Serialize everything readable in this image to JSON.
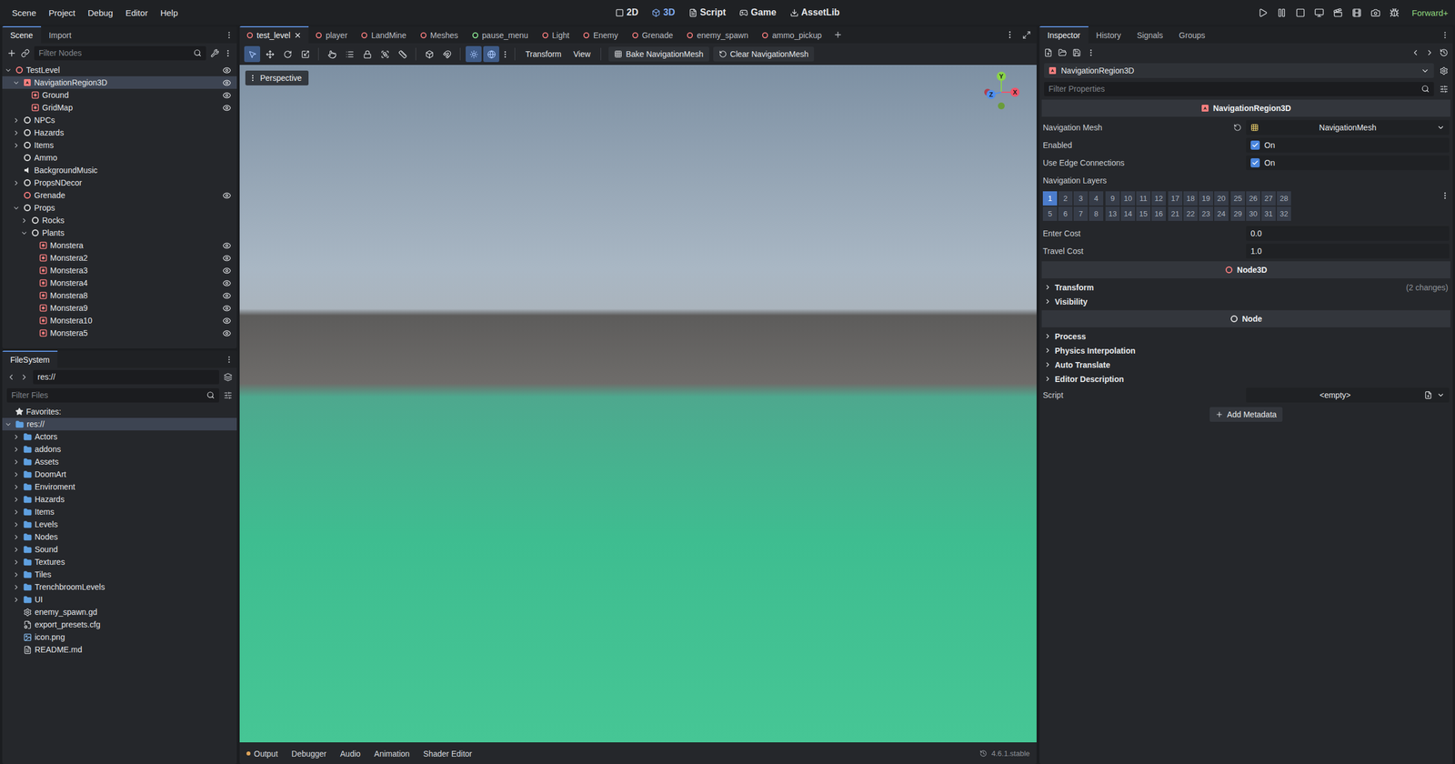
{
  "menu": [
    "Scene",
    "Project",
    "Debug",
    "Editor",
    "Help"
  ],
  "workspaces": [
    {
      "label": "2D",
      "selected": false
    },
    {
      "label": "3D",
      "selected": true
    },
    {
      "label": "Script",
      "selected": false
    },
    {
      "label": "Game",
      "selected": false
    },
    {
      "label": "AssetLib",
      "selected": false
    }
  ],
  "renderer": "Forward+",
  "scene_dock": {
    "tabs": [
      {
        "label": "Scene",
        "selected": true
      },
      {
        "label": "Import",
        "selected": false
      }
    ],
    "filter_placeholder": "Filter Nodes",
    "tree": [
      {
        "name": "TestLevel",
        "depth": 0,
        "kind": "node3d",
        "expandable": true,
        "expanded": true,
        "selected": false,
        "eye": true
      },
      {
        "name": "NavigationRegion3D",
        "depth": 1,
        "kind": "navregion",
        "expandable": true,
        "expanded": true,
        "selected": true,
        "eye": true
      },
      {
        "name": "Ground",
        "depth": 2,
        "kind": "instance",
        "expandable": false,
        "expanded": false,
        "selected": false,
        "eye": true
      },
      {
        "name": "GridMap",
        "depth": 2,
        "kind": "instance",
        "expandable": false,
        "expanded": false,
        "selected": false,
        "eye": true
      },
      {
        "name": "NPCs",
        "depth": 1,
        "kind": "node",
        "expandable": true,
        "expanded": false,
        "selected": false,
        "eye": false
      },
      {
        "name": "Hazards",
        "depth": 1,
        "kind": "node",
        "expandable": true,
        "expanded": false,
        "selected": false,
        "eye": false
      },
      {
        "name": "Items",
        "depth": 1,
        "kind": "node",
        "expandable": true,
        "expanded": false,
        "selected": false,
        "eye": false
      },
      {
        "name": "Ammo",
        "depth": 1,
        "kind": "node",
        "expandable": false,
        "expanded": false,
        "selected": false,
        "eye": false
      },
      {
        "name": "BackgroundMusic",
        "depth": 1,
        "kind": "audio",
        "expandable": false,
        "expanded": false,
        "selected": false,
        "eye": false
      },
      {
        "name": "PropsNDecor",
        "depth": 1,
        "kind": "node",
        "expandable": true,
        "expanded": false,
        "selected": false,
        "eye": false
      },
      {
        "name": "Grenade",
        "depth": 1,
        "kind": "node3d",
        "expandable": false,
        "expanded": false,
        "selected": false,
        "eye": true
      },
      {
        "name": "Props",
        "depth": 1,
        "kind": "node",
        "expandable": true,
        "expanded": true,
        "selected": false,
        "eye": false
      },
      {
        "name": "Rocks",
        "depth": 2,
        "kind": "node",
        "expandable": true,
        "expanded": false,
        "selected": false,
        "eye": false
      },
      {
        "name": "Plants",
        "depth": 2,
        "kind": "node",
        "expandable": true,
        "expanded": true,
        "selected": false,
        "eye": false
      },
      {
        "name": "Monstera",
        "depth": 3,
        "kind": "instance",
        "expandable": false,
        "expanded": false,
        "selected": false,
        "eye": true
      },
      {
        "name": "Monstera2",
        "depth": 3,
        "kind": "instance",
        "expandable": false,
        "expanded": false,
        "selected": false,
        "eye": true
      },
      {
        "name": "Monstera3",
        "depth": 3,
        "kind": "instance",
        "expandable": false,
        "expanded": false,
        "selected": false,
        "eye": true
      },
      {
        "name": "Monstera4",
        "depth": 3,
        "kind": "instance",
        "expandable": false,
        "expanded": false,
        "selected": false,
        "eye": true
      },
      {
        "name": "Monstera8",
        "depth": 3,
        "kind": "instance",
        "expandable": false,
        "expanded": false,
        "selected": false,
        "eye": true
      },
      {
        "name": "Monstera9",
        "depth": 3,
        "kind": "instance",
        "expandable": false,
        "expanded": false,
        "selected": false,
        "eye": true
      },
      {
        "name": "Monstera10",
        "depth": 3,
        "kind": "instance",
        "expandable": false,
        "expanded": false,
        "selected": false,
        "eye": true
      },
      {
        "name": "Monstera5",
        "depth": 3,
        "kind": "instance",
        "expandable": false,
        "expanded": false,
        "selected": false,
        "eye": true
      }
    ]
  },
  "filesystem": {
    "title": "FileSystem",
    "path": "res://",
    "filter_placeholder": "Filter Files",
    "favorites": "Favorites:",
    "root": "res://",
    "items": [
      {
        "name": "Actors",
        "kind": "folder"
      },
      {
        "name": "addons",
        "kind": "folder"
      },
      {
        "name": "Assets",
        "kind": "folder"
      },
      {
        "name": "DoomArt",
        "kind": "folder"
      },
      {
        "name": "Enviroment",
        "kind": "folder"
      },
      {
        "name": "Hazards",
        "kind": "folder"
      },
      {
        "name": "Items",
        "kind": "folder"
      },
      {
        "name": "Levels",
        "kind": "folder"
      },
      {
        "name": "Nodes",
        "kind": "folder"
      },
      {
        "name": "Sound",
        "kind": "folder"
      },
      {
        "name": "Textures",
        "kind": "folder"
      },
      {
        "name": "Tiles",
        "kind": "folder"
      },
      {
        "name": "TrenchbroomLevels",
        "kind": "folder"
      },
      {
        "name": "UI",
        "kind": "folder"
      },
      {
        "name": "enemy_spawn.gd",
        "kind": "script"
      },
      {
        "name": "export_presets.cfg",
        "kind": "config"
      },
      {
        "name": "icon.png",
        "kind": "image"
      },
      {
        "name": "README.md",
        "kind": "text"
      }
    ]
  },
  "editor_tabs": [
    {
      "label": "test_level",
      "kind": "3d",
      "selected": true
    },
    {
      "label": "player",
      "kind": "3d",
      "selected": false
    },
    {
      "label": "LandMine",
      "kind": "3d",
      "selected": false
    },
    {
      "label": "Meshes",
      "kind": "3d",
      "selected": false
    },
    {
      "label": "pause_menu",
      "kind": "ui",
      "selected": false
    },
    {
      "label": "Light",
      "kind": "3d",
      "selected": false
    },
    {
      "label": "Enemy",
      "kind": "3d",
      "selected": false
    },
    {
      "label": "Grenade",
      "kind": "3d",
      "selected": false
    },
    {
      "label": "enemy_spawn",
      "kind": "3d",
      "selected": false
    },
    {
      "label": "ammo_pickup",
      "kind": "3d",
      "selected": false
    }
  ],
  "toolbar": {
    "tools": [
      {
        "selected": true
      },
      {
        "selected": false
      },
      {
        "selected": false
      },
      {
        "selected": false
      },
      {
        "selected": false
      },
      {
        "selected": false
      },
      {
        "selected": false
      },
      {
        "selected": false
      },
      {
        "selected": false
      },
      {
        "selected": false
      },
      {
        "selected": false
      },
      {
        "selected": true
      },
      {
        "selected": true
      }
    ],
    "menus": [
      "Transform",
      "View"
    ],
    "actions": [
      "Bake NavigationMesh",
      "Clear NavigationMesh"
    ]
  },
  "viewport": {
    "view": "Perspective",
    "gizmo": [
      "Y",
      "Z",
      "X"
    ]
  },
  "bottom_panel": {
    "tabs": [
      "Output",
      "Debugger",
      "Audio",
      "Animation",
      "Shader Editor"
    ],
    "version": "4.6.1.stable"
  },
  "inspector": {
    "tabs": [
      {
        "label": "Inspector",
        "selected": true
      },
      {
        "label": "History",
        "selected": false
      },
      {
        "label": "Signals",
        "selected": false
      },
      {
        "label": "Groups",
        "selected": false
      }
    ],
    "node": "NavigationRegion3D",
    "filter_placeholder": "Filter Properties",
    "rows": [
      {
        "kind": "header",
        "label": "NavigationRegion3D",
        "icon": "navregion"
      },
      {
        "kind": "resource",
        "label": "Navigation Mesh",
        "value": "NavigationMesh"
      },
      {
        "kind": "check",
        "label": "Enabled",
        "checked": true,
        "value": "On"
      },
      {
        "kind": "check",
        "label": "Use Edge Connections",
        "checked": true,
        "value": "On"
      },
      {
        "kind": "layers",
        "label": "Navigation Layers",
        "layers": [
          {
            "label": "1",
            "selected": true
          },
          {
            "label": "2",
            "selected": false
          },
          {
            "label": "3",
            "selected": false
          },
          {
            "label": "4",
            "selected": false
          },
          {
            "label": "5",
            "selected": false
          },
          {
            "label": "6",
            "selected": false
          },
          {
            "label": "7",
            "selected": false
          },
          {
            "label": "8",
            "selected": false
          },
          {
            "label": "9",
            "selected": false
          },
          {
            "label": "10",
            "selected": false
          },
          {
            "label": "11",
            "selected": false
          },
          {
            "label": "12",
            "selected": false
          },
          {
            "label": "13",
            "selected": false
          },
          {
            "label": "14",
            "selected": false
          },
          {
            "label": "15",
            "selected": false
          },
          {
            "label": "16",
            "selected": false
          },
          {
            "label": "17",
            "selected": false
          },
          {
            "label": "18",
            "selected": false
          },
          {
            "label": "19",
            "selected": false
          },
          {
            "label": "20",
            "selected": false
          },
          {
            "label": "21",
            "selected": false
          },
          {
            "label": "22",
            "selected": false
          },
          {
            "label": "23",
            "selected": false
          },
          {
            "label": "24",
            "selected": false
          },
          {
            "label": "25",
            "selected": false
          },
          {
            "label": "26",
            "selected": false
          },
          {
            "label": "27",
            "selected": false
          },
          {
            "label": "28",
            "selected": false
          },
          {
            "label": "29",
            "selected": false
          },
          {
            "label": "30",
            "selected": false
          },
          {
            "label": "31",
            "selected": false
          },
          {
            "label": "32",
            "selected": false
          }
        ]
      },
      {
        "kind": "number",
        "label": "Enter Cost",
        "value": "0.0"
      },
      {
        "kind": "number",
        "label": "Travel Cost",
        "value": "1.0"
      },
      {
        "kind": "header",
        "label": "Node3D",
        "icon": "node3d"
      },
      {
        "kind": "group",
        "label": "Transform",
        "note": "(2 changes)",
        "expanded": false
      },
      {
        "kind": "group",
        "label": "Visibility",
        "note": "",
        "expanded": false
      },
      {
        "kind": "header",
        "label": "Node",
        "icon": "node"
      },
      {
        "kind": "group",
        "label": "Process",
        "note": "",
        "expanded": false
      },
      {
        "kind": "group",
        "label": "Physics Interpolation",
        "note": "",
        "expanded": false
      },
      {
        "kind": "group",
        "label": "Auto Translate",
        "note": "",
        "expanded": false
      },
      {
        "kind": "group",
        "label": "Editor Description",
        "note": "",
        "expanded": false
      },
      {
        "kind": "dropdown",
        "label": "Script",
        "value": "<empty>"
      },
      {
        "kind": "button",
        "label": "Add Metadata"
      }
    ]
  }
}
